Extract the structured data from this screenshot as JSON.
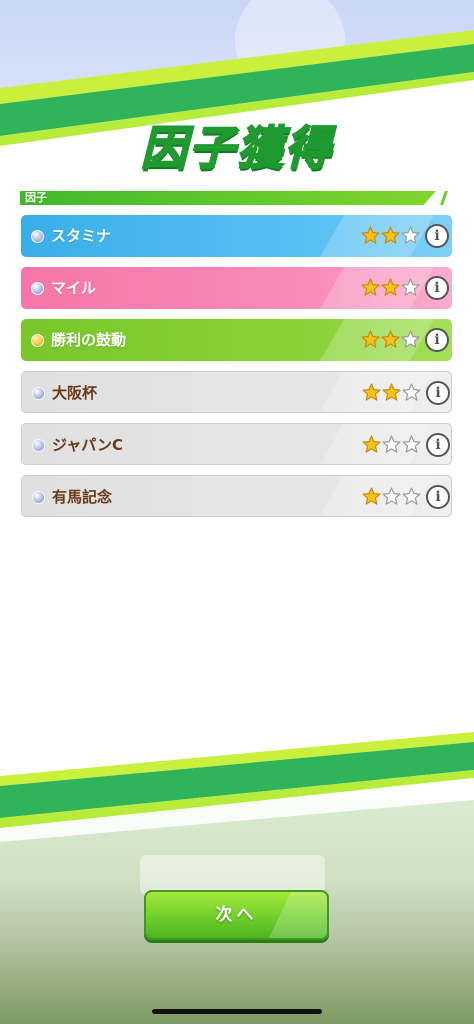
{
  "title": "因子獲得",
  "section": {
    "label": "因子"
  },
  "factors": [
    {
      "name": "スタミナ",
      "stars": 2,
      "max_stars": 3,
      "row_style": "blue",
      "bullet": "blue",
      "bullet_icon": "orb-icon"
    },
    {
      "name": "マイル",
      "stars": 2,
      "max_stars": 3,
      "row_style": "pink",
      "bullet": "blue",
      "bullet_icon": "orb-icon"
    },
    {
      "name": "勝利の鼓動",
      "stars": 2,
      "max_stars": 3,
      "row_style": "green",
      "bullet": "gold",
      "bullet_icon": "orb-icon"
    },
    {
      "name": "大阪杯",
      "stars": 2,
      "max_stars": 3,
      "row_style": "grey",
      "bullet": "blue",
      "bullet_icon": "orb-icon"
    },
    {
      "name": "ジャパンC",
      "stars": 1,
      "max_stars": 3,
      "row_style": "grey",
      "bullet": "blue",
      "bullet_icon": "orb-icon"
    },
    {
      "name": "有馬記念",
      "stars": 1,
      "max_stars": 3,
      "row_style": "grey",
      "bullet": "blue",
      "bullet_icon": "orb-icon"
    }
  ],
  "info_icon": "i",
  "next_button": {
    "label": "次へ"
  },
  "colors": {
    "blue_row": "#45b3ec",
    "pink_row": "#f77eae",
    "green_row": "#7fcc2e",
    "grey_row": "#e2e2e2",
    "star_filled": "#f5c21b",
    "star_empty": "#ffffff",
    "accent_green": "#6fcf2a"
  }
}
